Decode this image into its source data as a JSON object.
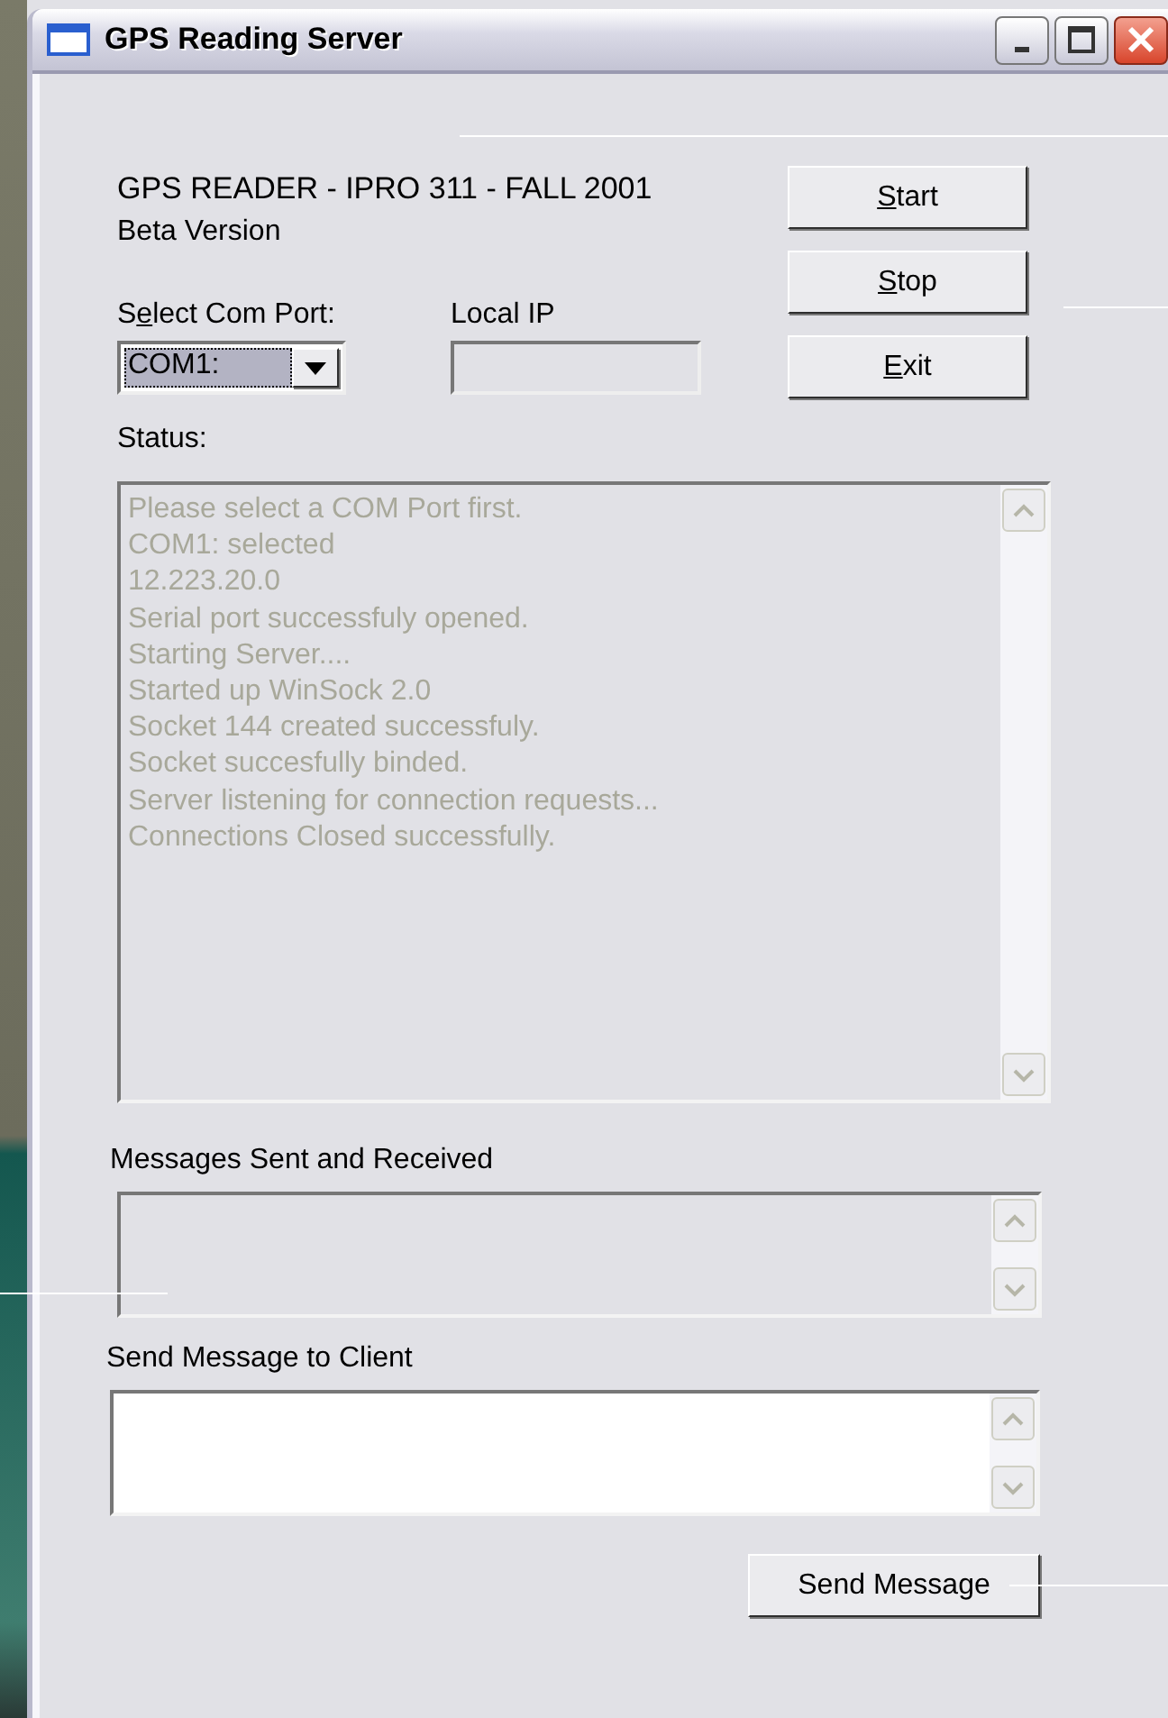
{
  "window": {
    "title": "GPS Reading Server"
  },
  "header": {
    "lines": [
      "GPS READER - IPRO 311 - FALL 2001",
      "Beta Version"
    ]
  },
  "com_port": {
    "text_before": "S",
    "access_key": "e",
    "text_after": "lect Com Port:",
    "value": "COM1:",
    "focused": true
  },
  "local_ip": {
    "label": "Local IP",
    "disabled": true
  },
  "buttons": [
    {
      "access_key": "S",
      "text_after": "tart"
    },
    {
      "access_key": "S",
      "text_after": "top"
    },
    {
      "access_key": "E",
      "text_after": "xit"
    }
  ],
  "status": {
    "label": "Status:",
    "disabled": true,
    "lines": [
      "Please select a COM Port first.",
      "COM1: selected",
      "12.223.20.0",
      "Serial port successfuly opened.",
      "Starting Server....",
      "Started up WinSock 2.0",
      "Socket 144 created successfuly.",
      "Socket succesfully binded.",
      "Server listening for connection requests...",
      "Connections Closed successfully."
    ]
  },
  "messages": {
    "label": "Messages Sent and Received",
    "disabled": true
  },
  "send_box": {
    "label": "Send Message to Client",
    "disabled": false
  },
  "send_button": {
    "label": "Send Message"
  }
}
